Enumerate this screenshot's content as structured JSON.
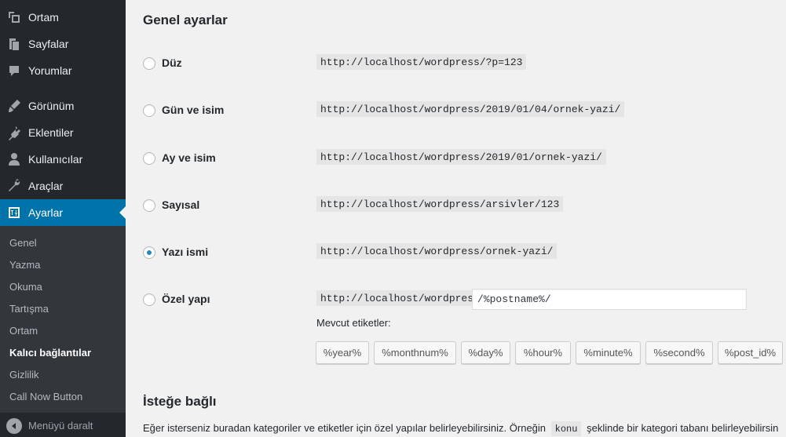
{
  "sidebar": {
    "menu": [
      {
        "label": "Ortam",
        "icon": "media-icon"
      },
      {
        "label": "Sayfalar",
        "icon": "pages-icon"
      },
      {
        "label": "Yorumlar",
        "icon": "comments-icon"
      },
      {
        "label": "Görünüm",
        "icon": "appearance-icon"
      },
      {
        "label": "Eklentiler",
        "icon": "plugins-icon"
      },
      {
        "label": "Kullanıcılar",
        "icon": "users-icon"
      },
      {
        "label": "Araçlar",
        "icon": "tools-icon"
      },
      {
        "label": "Ayarlar",
        "icon": "settings-icon"
      }
    ],
    "submenu": [
      {
        "label": "Genel"
      },
      {
        "label": "Yazma"
      },
      {
        "label": "Okuma"
      },
      {
        "label": "Tartışma"
      },
      {
        "label": "Ortam"
      },
      {
        "label": "Kalıcı bağlantılar"
      },
      {
        "label": "Gizlilik"
      },
      {
        "label": "Call Now Button"
      }
    ],
    "collapse_label": "Menüyü daralt"
  },
  "main": {
    "general_title": "Genel ayarlar",
    "options": [
      {
        "label": "Düz",
        "url": "http://localhost/wordpress/?p=123",
        "checked": false
      },
      {
        "label": "Gün ve isim",
        "url": "http://localhost/wordpress/2019/01/04/ornek-yazi/",
        "checked": false
      },
      {
        "label": "Ay ve isim",
        "url": "http://localhost/wordpress/2019/01/ornek-yazi/",
        "checked": false
      },
      {
        "label": "Sayısal",
        "url": "http://localhost/wordpress/arsivler/123",
        "checked": false
      },
      {
        "label": "Yazı ismi",
        "url": "http://localhost/wordpress/ornek-yazi/",
        "checked": true
      },
      {
        "label": "Özel yapı",
        "url": "http://localhost/wordpress",
        "checked": false
      }
    ],
    "custom_structure_value": "/%postname%/",
    "available_tags_label": "Mevcut etiketler:",
    "tags": [
      "%year%",
      "%monthnum%",
      "%day%",
      "%hour%",
      "%minute%",
      "%second%",
      "%post_id%"
    ],
    "optional_title": "İsteğe bağlı",
    "optional_desc_before": "Eğer isterseniz buradan kategoriler ve etiketler için özel yapılar belirleyebilirsiniz. Örneğin",
    "optional_desc_code": "konu",
    "optional_desc_after": "şeklinde bir kategori tabanı belirleyebilirsin"
  },
  "colors": {
    "sidebar_bg": "#23282d",
    "submenu_bg": "#32373c",
    "accent": "#0073aa",
    "content_bg": "#f1f1f1"
  }
}
